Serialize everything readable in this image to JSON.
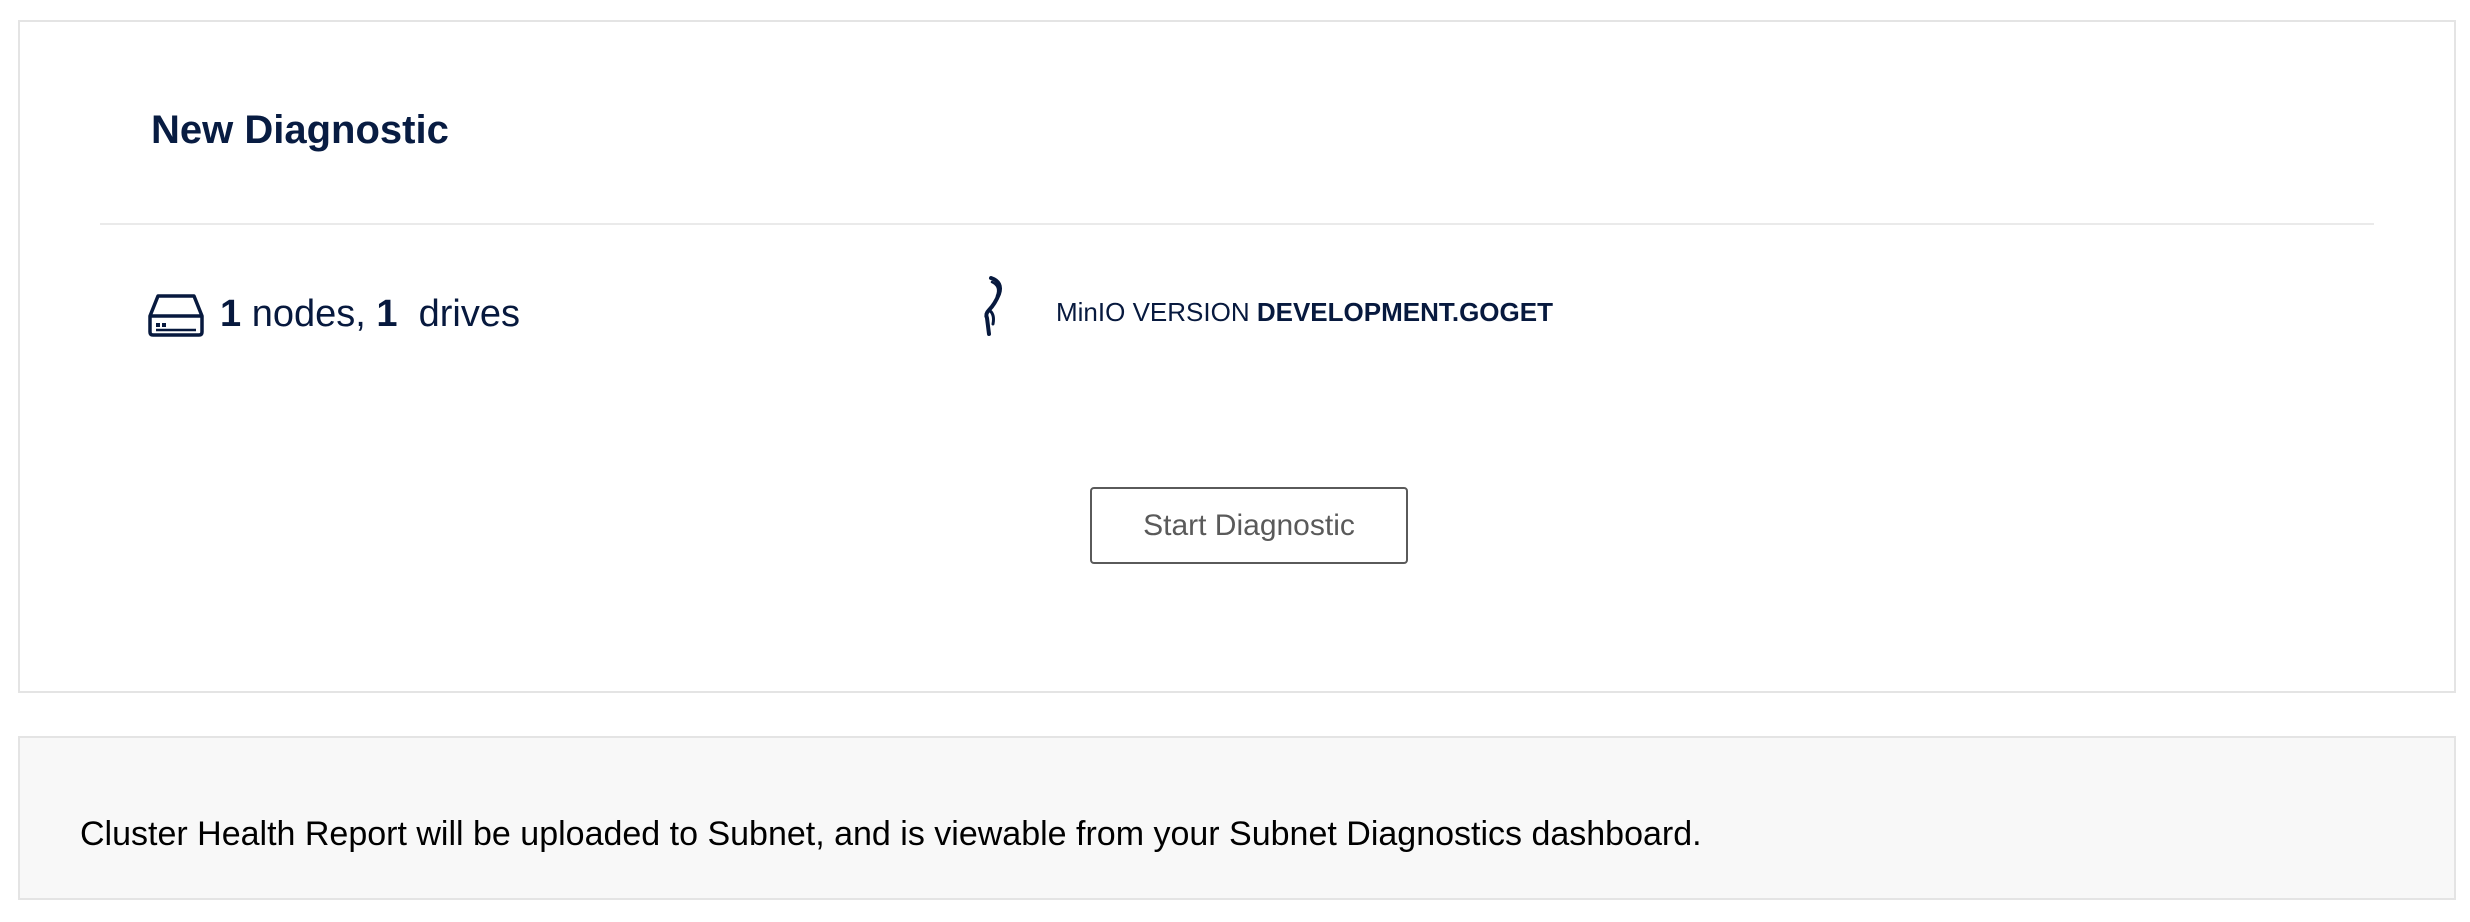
{
  "diagnostic": {
    "title": "New Diagnostic",
    "counts": {
      "nodes_value": "1",
      "nodes_label": " nodes, ",
      "drives_value": "1",
      "drives_label": "  drives"
    },
    "version": {
      "prefix": "MinIO VERSION ",
      "value": "DEVELOPMENT.GOGET"
    },
    "start_button_label": "Start Diagnostic"
  },
  "info": {
    "message": "Cluster Health Report will be uploaded to Subnet, and is viewable from your Subnet Diagnostics dashboard."
  },
  "icons": {
    "drive": "hard-drive-icon",
    "version": "minio-bird-icon"
  },
  "colors": {
    "text_primary": "#07193e",
    "border": "#e4e4e4",
    "info_background": "#f8f8f8",
    "button_text": "#5a5a5a"
  }
}
